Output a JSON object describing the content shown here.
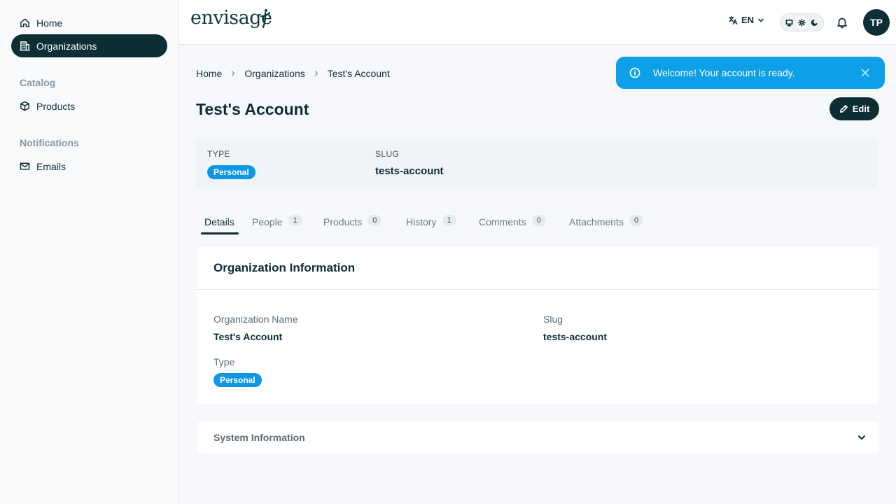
{
  "sidebar": {
    "items": [
      {
        "label": "Home",
        "icon": "home-icon"
      },
      {
        "label": "Organizations",
        "icon": "building-icon",
        "active": true
      }
    ],
    "sections": [
      {
        "title": "Catalog",
        "items": [
          {
            "label": "Products",
            "icon": "box-icon"
          }
        ]
      },
      {
        "title": "Notifications",
        "items": [
          {
            "label": "Emails",
            "icon": "mail-icon"
          }
        ]
      }
    ]
  },
  "header": {
    "logo": "envisage",
    "language": "EN",
    "avatar_initials": "TP"
  },
  "breadcrumb": [
    "Home",
    "Organizations",
    "Test's Account"
  ],
  "page": {
    "title": "Test's Account",
    "edit_label": "Edit"
  },
  "summary": {
    "type_label": "TYPE",
    "type_value": "Personal",
    "slug_label": "SLUG",
    "slug_value": "tests-account"
  },
  "tabs": [
    {
      "label": "Details",
      "count": null,
      "active": true
    },
    {
      "label": "People",
      "count": "1"
    },
    {
      "label": "Products",
      "count": "0"
    },
    {
      "label": "History",
      "count": "1"
    },
    {
      "label": "Comments",
      "count": "0"
    },
    {
      "label": "Attachments",
      "count": "0"
    }
  ],
  "org_info": {
    "title": "Organization Information",
    "name_label": "Organization Name",
    "name_value": "Test's Account",
    "slug_label": "Slug",
    "slug_value": "tests-account",
    "type_label": "Type",
    "type_value": "Personal"
  },
  "system_info": {
    "title": "System Information"
  },
  "toast": {
    "message": "Welcome! Your account is ready."
  },
  "colors": {
    "primary": "#0e2e36",
    "badge": "#0d98e6",
    "toast": "#0d9fe8"
  }
}
